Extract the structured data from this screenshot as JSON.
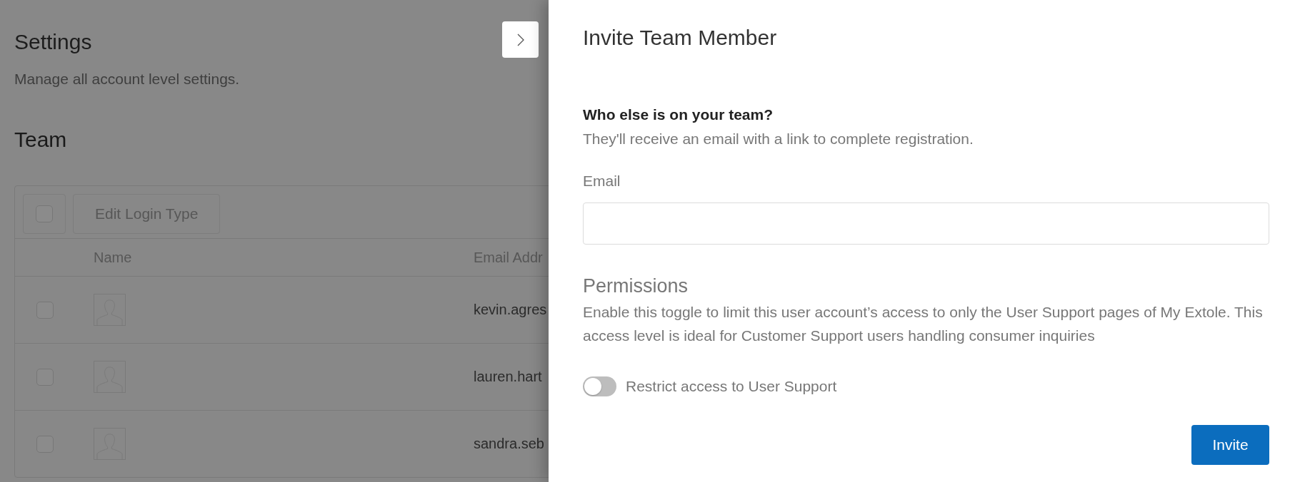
{
  "page": {
    "title": "Settings",
    "subtitle": "Manage all account level settings.",
    "section_title": "Team"
  },
  "team_table": {
    "toolbar": {
      "select_all": {
        "checked": false
      },
      "actions": [
        "Edit Login Type"
      ]
    },
    "columns": [
      "Name",
      "Email Addr"
    ],
    "rows": [
      {
        "checked": false,
        "email": "kevin.agres"
      },
      {
        "checked": false,
        "email": "lauren.hart"
      },
      {
        "checked": false,
        "email": "sandra.seb"
      }
    ]
  },
  "drawer": {
    "title": "Invite Team Member",
    "question": "Who else is on your team?",
    "hint": "They'll receive an email with a link to complete registration.",
    "email_field": {
      "label": "Email"
    },
    "permissions": {
      "title": "Permissions",
      "description": "Enable this toggle to limit this user account’s access to only the User Support pages of My Extole. This access level is ideal for Customer Support users handling consumer inquiries",
      "toggle": {
        "label": "Restrict access to User Support",
        "on": false
      }
    },
    "submit": "Invite"
  }
}
